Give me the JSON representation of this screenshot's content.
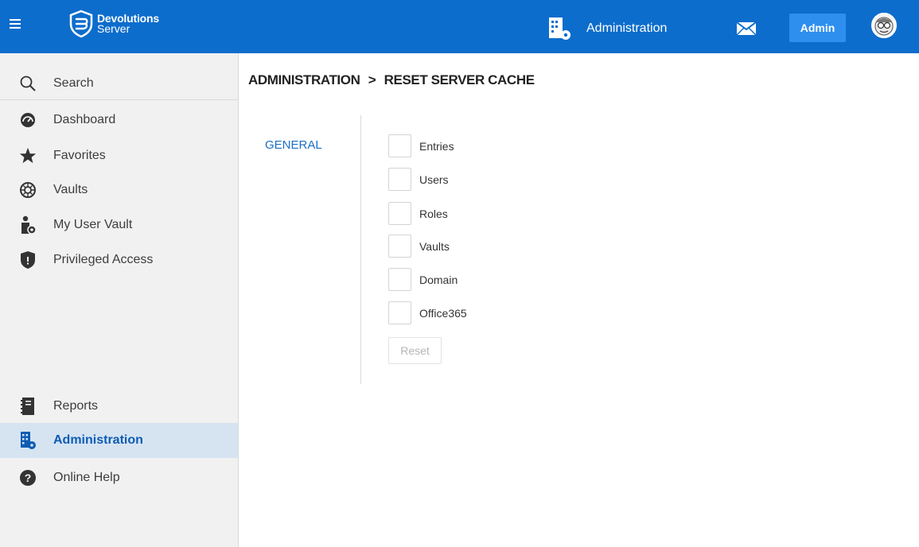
{
  "topbar": {
    "brand_line1": "Devolutions",
    "brand_line2": "Server",
    "section_label": "Administration",
    "admin_button": "Admin",
    "colors": {
      "bar": "#0d6dcc",
      "button": "#2f8fef"
    }
  },
  "sidebar": {
    "items": [
      {
        "label": "Search",
        "icon": "search-icon"
      },
      {
        "label": "Dashboard",
        "icon": "dashboard-icon"
      },
      {
        "label": "Favorites",
        "icon": "star-icon"
      },
      {
        "label": "Vaults",
        "icon": "vault-icon"
      },
      {
        "label": "My User Vault",
        "icon": "user-vault-icon"
      },
      {
        "label": "Privileged Access",
        "icon": "shield-icon"
      },
      {
        "label": "Reports",
        "icon": "reports-icon"
      },
      {
        "label": "Administration",
        "icon": "administration-icon",
        "active": true
      },
      {
        "label": "Online Help",
        "icon": "help-icon"
      }
    ]
  },
  "main": {
    "breadcrumb": {
      "root": "ADMINISTRATION",
      "separator": ">",
      "current": "RESET SERVER CACHE"
    },
    "tabs": [
      {
        "label": "GENERAL",
        "active": true
      }
    ],
    "checkboxes": [
      {
        "label": "Entries",
        "checked": false
      },
      {
        "label": "Users",
        "checked": false
      },
      {
        "label": "Roles",
        "checked": false
      },
      {
        "label": "Vaults",
        "checked": false
      },
      {
        "label": "Domain",
        "checked": false
      },
      {
        "label": "Office365",
        "checked": false
      }
    ],
    "reset_button": "Reset"
  }
}
